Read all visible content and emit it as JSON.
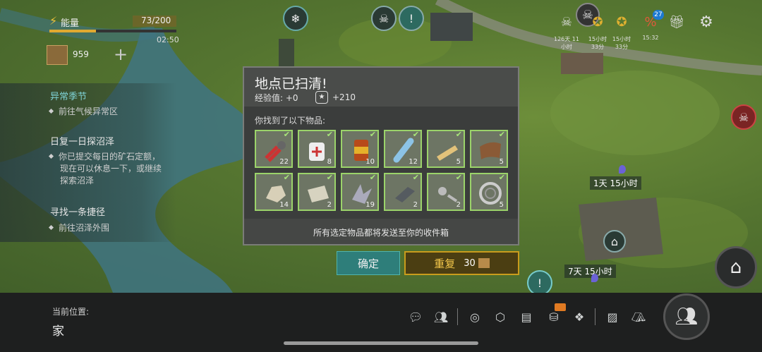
{
  "energy": {
    "label": "能量",
    "value_text": "73/200",
    "fraction": 0.365,
    "timer": "02:50"
  },
  "resource": {
    "count": "959"
  },
  "quests": [
    {
      "title": "异常季节",
      "lines": [
        "前往气候异常区"
      ]
    },
    {
      "title": "日复一日探沼泽",
      "lines": [
        "你已提交每日的矿石定额，",
        "现在可以休息一下，或继续",
        "探索沼泽"
      ]
    },
    {
      "title": "寻找一条捷径",
      "lines": [
        "前往沼泽外围"
      ]
    }
  ],
  "top_bar": {
    "skull_caption_1": "126天 11",
    "skull_caption_2": "小时",
    "timer_a_1": "15小时",
    "timer_a_2": "33分",
    "timer_b_1": "15小时",
    "timer_b_2": "33分",
    "sale_badge": "27",
    "sale_caption": "15:32"
  },
  "map_labels": {
    "pin_1": "1天 15小时",
    "pin_2": "7天 15小时"
  },
  "modal": {
    "title": "地点已扫清!",
    "xp_label": "经验值:",
    "xp_value": "+0",
    "rep_value": "+210",
    "found_label": "你找到了以下物品:",
    "footer": "所有选定物品都将发送至你的收件箱",
    "items": [
      {
        "icon": "pliers-tools-icon",
        "count": "22"
      },
      {
        "icon": "bandage-icon",
        "count": "8"
      },
      {
        "icon": "canned-food-icon",
        "count": "10"
      },
      {
        "icon": "water-bottle-icon",
        "count": "12"
      },
      {
        "icon": "wood-plank-icon",
        "count": "5"
      },
      {
        "icon": "leather-icon",
        "count": "5"
      },
      {
        "icon": "stone-icon",
        "count": "14"
      },
      {
        "icon": "limestone-icon",
        "count": "2"
      },
      {
        "icon": "metal-scrap-icon",
        "count": "19"
      },
      {
        "icon": "iron-ingot-icon",
        "count": "2"
      },
      {
        "icon": "bolts-nuts-icon",
        "count": "2"
      },
      {
        "icon": "bearing-icon",
        "count": "5"
      }
    ]
  },
  "buttons": {
    "confirm": "确定",
    "repeat": "重复",
    "repeat_cost": "30"
  },
  "location": {
    "label": "当前位置:",
    "value": "家"
  },
  "colors": {
    "accent_teal": "#2e7e7a",
    "gold": "#c99c1c",
    "check_green": "#9bd36a"
  }
}
